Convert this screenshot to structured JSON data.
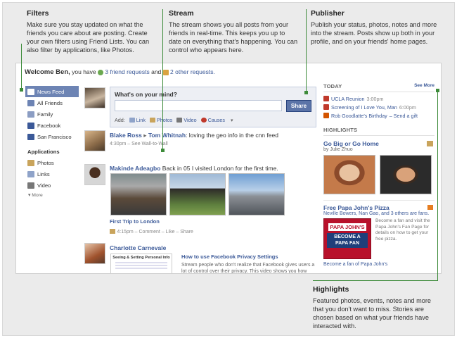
{
  "callouts": {
    "filters": {
      "title": "Filters",
      "text": "Make sure you stay updated on what the friends you care about are posting. Create your own filters using Friend Lists. You can also filter by applications, like Photos."
    },
    "stream": {
      "title": "Stream",
      "text": "The stream shows you all posts from your friends in real-time. This keeps you up to date on everything that's happening. You can control who appears here."
    },
    "publisher": {
      "title": "Publisher",
      "text": "Publish your status, photos, notes and more into the stream. Posts show up both in your profile, and on your friends' home pages."
    },
    "highlights": {
      "title": "Highlights",
      "text": "Featured photos, events, notes and more that you don't want to miss. Stories are chosen based on what your friends have interacted with."
    }
  },
  "welcome": {
    "greeting": "Welcome Ben,",
    "you_have": "you have",
    "friend_requests": "3 friend requests",
    "and": "and",
    "other_requests": "2 other requests."
  },
  "sidebar": {
    "filters": [
      {
        "label": "News Feed",
        "active": true
      },
      {
        "label": "All Friends"
      },
      {
        "label": "Family"
      },
      {
        "label": "Facebook"
      },
      {
        "label": "San Francisco"
      }
    ],
    "applications_heading": "Applications",
    "applications": [
      {
        "label": "Photos"
      },
      {
        "label": "Links"
      },
      {
        "label": "Video"
      }
    ],
    "more": "▾ More"
  },
  "publisher": {
    "prompt": "What's on your mind?",
    "share": "Share",
    "add_label": "Add:",
    "actions": [
      "Link",
      "Photos",
      "Video",
      "Causes"
    ]
  },
  "stories": {
    "s1": {
      "name": "Blake Ross",
      "arrow": "▸",
      "target": "Tom Whitnah",
      "text": ": loving the geo info in the cnn feed",
      "meta": "4:30pm – See Wall-to-Wall"
    },
    "s2": {
      "name": "Makinde Adeagbo",
      "text": " Back in 05 I visited London for the first time.",
      "album": "First Trip to London",
      "meta": "4:15pm – Comment – Like – Share"
    },
    "s3": {
      "name": "Charlotte Carnevale",
      "link_title": "How to use Facebook Privacy Settings",
      "thumb_title": "Seeing & Setting Personal Info",
      "desc": "Stream people who don't realize that Facebook gives users a lot of control over their privacy. This video shows you how"
    }
  },
  "right": {
    "today_heading": "Today",
    "see_more": "See More",
    "events": [
      {
        "title": "UCLA Reunion",
        "time": "3:00pm"
      },
      {
        "title": "Screening of I Love You, Man",
        "time": "6:00pm"
      },
      {
        "title": "Rob Goodlatte's Birthday",
        "time": "– Send a gift"
      }
    ],
    "highlights_heading": "Highlights",
    "hl1": {
      "title": "Go Big or Go Home",
      "sub": "by Julie Zhuo"
    },
    "hl2": {
      "title": "Free Papa John's Pizza",
      "friends": "Neville Bowers, Nan Gao, and 3 others are fans.",
      "ad_text": "Become a fan and visit the Papa John's Fan Page for details on how to get your free pizza.",
      "logo": "PAPA JOHN'S",
      "banner": "BECOME A PAPA FAN",
      "cta": "Become a fan of Papa John's"
    }
  },
  "colors": {
    "accent": "#3b5998",
    "callout_line": "#3d8b3a",
    "active_filter": "#6d84b4"
  }
}
